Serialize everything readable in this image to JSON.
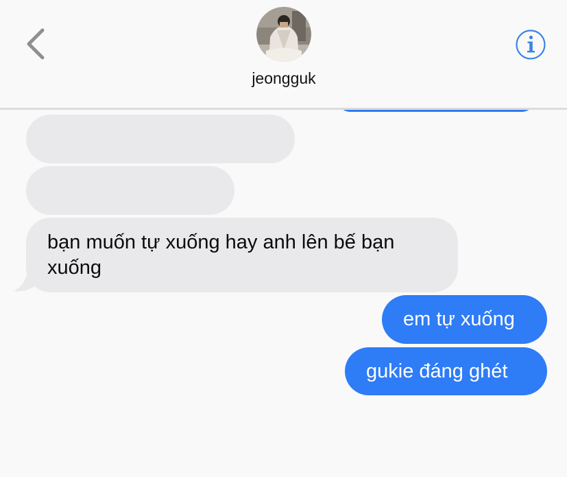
{
  "header": {
    "contact_name": "jeongguk",
    "avatar_icon": "contact-photo",
    "back_icon": "chevron-left-icon",
    "info_icon": "info-icon"
  },
  "colors": {
    "sent_bubble": "#2e7cf6",
    "received_bubble": "#e9e9eb",
    "background": "#f9f9f9",
    "accent": "#3a83e6"
  },
  "messages": [
    {
      "direction": "received",
      "text": ""
    },
    {
      "direction": "received",
      "text": ""
    },
    {
      "direction": "received",
      "text": "bạn muốn tự xuống hay anh lên bế bạn xuống"
    },
    {
      "direction": "sent",
      "text": "em tự xuống"
    },
    {
      "direction": "sent",
      "text": "gukie đáng ghét"
    }
  ]
}
